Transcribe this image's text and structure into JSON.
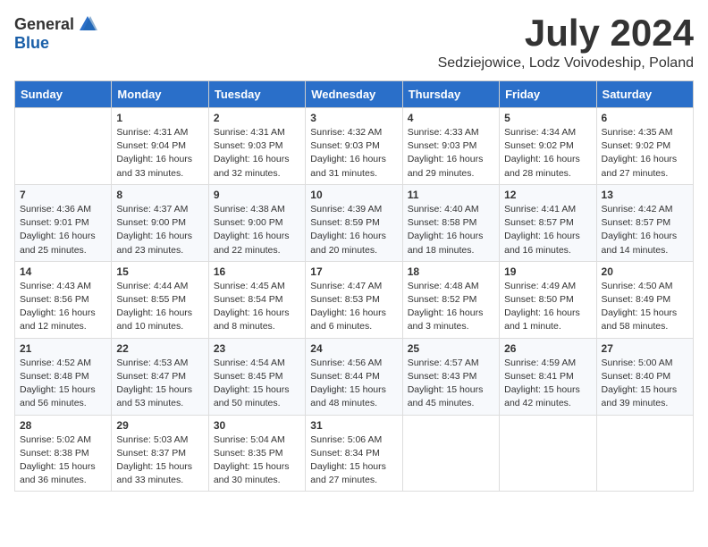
{
  "header": {
    "logo_general": "General",
    "logo_blue": "Blue",
    "month": "July 2024",
    "location": "Sedziejowice, Lodz Voivodeship, Poland"
  },
  "weekdays": [
    "Sunday",
    "Monday",
    "Tuesday",
    "Wednesday",
    "Thursday",
    "Friday",
    "Saturday"
  ],
  "weeks": [
    [
      {
        "day": "",
        "sunrise": "",
        "sunset": "",
        "daylight": ""
      },
      {
        "day": "1",
        "sunrise": "Sunrise: 4:31 AM",
        "sunset": "Sunset: 9:04 PM",
        "daylight": "Daylight: 16 hours and 33 minutes."
      },
      {
        "day": "2",
        "sunrise": "Sunrise: 4:31 AM",
        "sunset": "Sunset: 9:03 PM",
        "daylight": "Daylight: 16 hours and 32 minutes."
      },
      {
        "day": "3",
        "sunrise": "Sunrise: 4:32 AM",
        "sunset": "Sunset: 9:03 PM",
        "daylight": "Daylight: 16 hours and 31 minutes."
      },
      {
        "day": "4",
        "sunrise": "Sunrise: 4:33 AM",
        "sunset": "Sunset: 9:03 PM",
        "daylight": "Daylight: 16 hours and 29 minutes."
      },
      {
        "day": "5",
        "sunrise": "Sunrise: 4:34 AM",
        "sunset": "Sunset: 9:02 PM",
        "daylight": "Daylight: 16 hours and 28 minutes."
      },
      {
        "day": "6",
        "sunrise": "Sunrise: 4:35 AM",
        "sunset": "Sunset: 9:02 PM",
        "daylight": "Daylight: 16 hours and 27 minutes."
      }
    ],
    [
      {
        "day": "7",
        "sunrise": "Sunrise: 4:36 AM",
        "sunset": "Sunset: 9:01 PM",
        "daylight": "Daylight: 16 hours and 25 minutes."
      },
      {
        "day": "8",
        "sunrise": "Sunrise: 4:37 AM",
        "sunset": "Sunset: 9:00 PM",
        "daylight": "Daylight: 16 hours and 23 minutes."
      },
      {
        "day": "9",
        "sunrise": "Sunrise: 4:38 AM",
        "sunset": "Sunset: 9:00 PM",
        "daylight": "Daylight: 16 hours and 22 minutes."
      },
      {
        "day": "10",
        "sunrise": "Sunrise: 4:39 AM",
        "sunset": "Sunset: 8:59 PM",
        "daylight": "Daylight: 16 hours and 20 minutes."
      },
      {
        "day": "11",
        "sunrise": "Sunrise: 4:40 AM",
        "sunset": "Sunset: 8:58 PM",
        "daylight": "Daylight: 16 hours and 18 minutes."
      },
      {
        "day": "12",
        "sunrise": "Sunrise: 4:41 AM",
        "sunset": "Sunset: 8:57 PM",
        "daylight": "Daylight: 16 hours and 16 minutes."
      },
      {
        "day": "13",
        "sunrise": "Sunrise: 4:42 AM",
        "sunset": "Sunset: 8:57 PM",
        "daylight": "Daylight: 16 hours and 14 minutes."
      }
    ],
    [
      {
        "day": "14",
        "sunrise": "Sunrise: 4:43 AM",
        "sunset": "Sunset: 8:56 PM",
        "daylight": "Daylight: 16 hours and 12 minutes."
      },
      {
        "day": "15",
        "sunrise": "Sunrise: 4:44 AM",
        "sunset": "Sunset: 8:55 PM",
        "daylight": "Daylight: 16 hours and 10 minutes."
      },
      {
        "day": "16",
        "sunrise": "Sunrise: 4:45 AM",
        "sunset": "Sunset: 8:54 PM",
        "daylight": "Daylight: 16 hours and 8 minutes."
      },
      {
        "day": "17",
        "sunrise": "Sunrise: 4:47 AM",
        "sunset": "Sunset: 8:53 PM",
        "daylight": "Daylight: 16 hours and 6 minutes."
      },
      {
        "day": "18",
        "sunrise": "Sunrise: 4:48 AM",
        "sunset": "Sunset: 8:52 PM",
        "daylight": "Daylight: 16 hours and 3 minutes."
      },
      {
        "day": "19",
        "sunrise": "Sunrise: 4:49 AM",
        "sunset": "Sunset: 8:50 PM",
        "daylight": "Daylight: 16 hours and 1 minute."
      },
      {
        "day": "20",
        "sunrise": "Sunrise: 4:50 AM",
        "sunset": "Sunset: 8:49 PM",
        "daylight": "Daylight: 15 hours and 58 minutes."
      }
    ],
    [
      {
        "day": "21",
        "sunrise": "Sunrise: 4:52 AM",
        "sunset": "Sunset: 8:48 PM",
        "daylight": "Daylight: 15 hours and 56 minutes."
      },
      {
        "day": "22",
        "sunrise": "Sunrise: 4:53 AM",
        "sunset": "Sunset: 8:47 PM",
        "daylight": "Daylight: 15 hours and 53 minutes."
      },
      {
        "day": "23",
        "sunrise": "Sunrise: 4:54 AM",
        "sunset": "Sunset: 8:45 PM",
        "daylight": "Daylight: 15 hours and 50 minutes."
      },
      {
        "day": "24",
        "sunrise": "Sunrise: 4:56 AM",
        "sunset": "Sunset: 8:44 PM",
        "daylight": "Daylight: 15 hours and 48 minutes."
      },
      {
        "day": "25",
        "sunrise": "Sunrise: 4:57 AM",
        "sunset": "Sunset: 8:43 PM",
        "daylight": "Daylight: 15 hours and 45 minutes."
      },
      {
        "day": "26",
        "sunrise": "Sunrise: 4:59 AM",
        "sunset": "Sunset: 8:41 PM",
        "daylight": "Daylight: 15 hours and 42 minutes."
      },
      {
        "day": "27",
        "sunrise": "Sunrise: 5:00 AM",
        "sunset": "Sunset: 8:40 PM",
        "daylight": "Daylight: 15 hours and 39 minutes."
      }
    ],
    [
      {
        "day": "28",
        "sunrise": "Sunrise: 5:02 AM",
        "sunset": "Sunset: 8:38 PM",
        "daylight": "Daylight: 15 hours and 36 minutes."
      },
      {
        "day": "29",
        "sunrise": "Sunrise: 5:03 AM",
        "sunset": "Sunset: 8:37 PM",
        "daylight": "Daylight: 15 hours and 33 minutes."
      },
      {
        "day": "30",
        "sunrise": "Sunrise: 5:04 AM",
        "sunset": "Sunset: 8:35 PM",
        "daylight": "Daylight: 15 hours and 30 minutes."
      },
      {
        "day": "31",
        "sunrise": "Sunrise: 5:06 AM",
        "sunset": "Sunset: 8:34 PM",
        "daylight": "Daylight: 15 hours and 27 minutes."
      },
      {
        "day": "",
        "sunrise": "",
        "sunset": "",
        "daylight": ""
      },
      {
        "day": "",
        "sunrise": "",
        "sunset": "",
        "daylight": ""
      },
      {
        "day": "",
        "sunrise": "",
        "sunset": "",
        "daylight": ""
      }
    ]
  ]
}
